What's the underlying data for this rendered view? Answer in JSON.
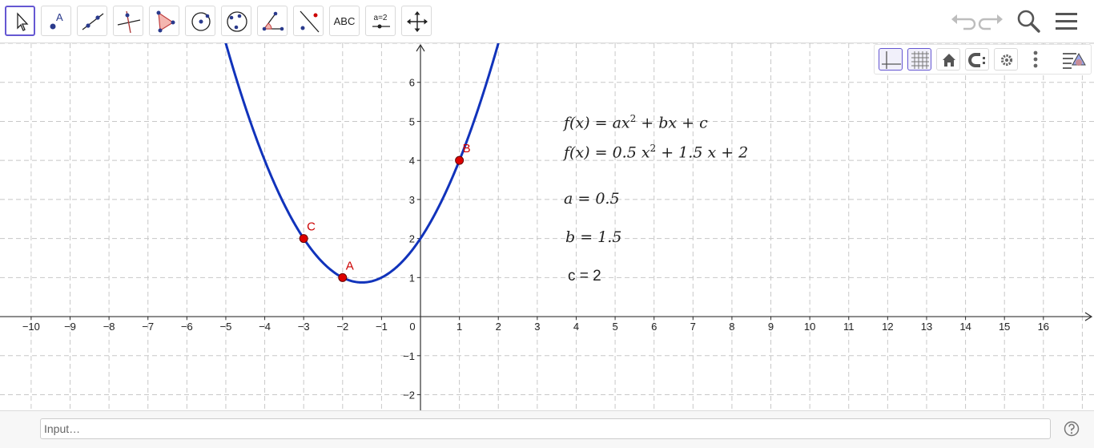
{
  "toolbar": {
    "tools": [
      {
        "name": "move-tool-icon",
        "label": ""
      },
      {
        "name": "point-tool-icon",
        "label": ""
      },
      {
        "name": "line-tool-icon",
        "label": ""
      },
      {
        "name": "perpendicular-line-tool-icon",
        "label": ""
      },
      {
        "name": "polygon-tool-icon",
        "label": ""
      },
      {
        "name": "circle-center-point-tool-icon",
        "label": ""
      },
      {
        "name": "circle-three-points-tool-icon",
        "label": ""
      },
      {
        "name": "angle-tool-icon",
        "label": ""
      },
      {
        "name": "reflect-tool-icon",
        "label": ""
      },
      {
        "name": "text-tool",
        "label": "ABC"
      },
      {
        "name": "slider-tool",
        "label": "a=2"
      },
      {
        "name": "move-graphics-view-icon",
        "label": ""
      }
    ],
    "right_icons": [
      "undo-icon",
      "redo-icon",
      "search-icon",
      "menu-icon"
    ]
  },
  "style_bar": {
    "buttons": [
      "toggle-axes-icon",
      "toggle-grid-icon",
      "home-icon",
      "point-capturing-icon",
      "settings-gear-icon",
      "more-options-icon",
      "style-bar-toggle-icon"
    ]
  },
  "graph": {
    "x_ticks": [
      -10,
      -9,
      -8,
      -7,
      -6,
      -5,
      -4,
      -3,
      -2,
      -1,
      0,
      1,
      2,
      3,
      4,
      5,
      6,
      7,
      8,
      9,
      10,
      11,
      12,
      13,
      14,
      15,
      16
    ],
    "y_ticks": [
      -2,
      -1,
      1,
      2,
      3,
      4,
      5,
      6
    ],
    "x_range": [
      -10.8,
      17.3
    ],
    "y_range": [
      -2.4,
      7.0
    ],
    "curve": {
      "a": 0.5,
      "b": 1.5,
      "c": 2,
      "color": "#1133bb"
    },
    "points": [
      {
        "label": "A",
        "x": -2,
        "y": 1,
        "color": "#dd0000"
      },
      {
        "label": "B",
        "x": 1,
        "y": 4,
        "color": "#dd0000"
      },
      {
        "label": "C",
        "x": -3,
        "y": 2,
        "color": "#dd0000"
      }
    ],
    "grid_color": "#c8c8c8",
    "axis_color": "#333333"
  },
  "formulas": {
    "general": {
      "lhs": "f(x) = ax",
      "sup": "2",
      "rhs": " + bx + c"
    },
    "specific": {
      "lhs": "f(x) = 0.5 x",
      "sup": "2",
      "rhs": " + 1.5 x + 2"
    },
    "a_value": "a = 0.5",
    "b_value": "b = 1.5",
    "c_value": "c = 2"
  },
  "input_bar": {
    "placeholder": "Input…",
    "help_icon": "help-icon"
  }
}
